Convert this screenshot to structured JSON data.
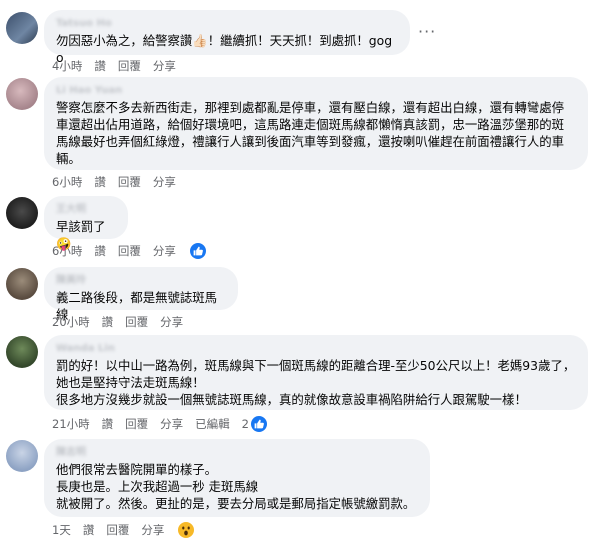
{
  "colors": {
    "bubble": "#f0f2f5",
    "meta_text": "#65676b",
    "like_blue": "#1877f2",
    "wow_yellow": "#f7b928"
  },
  "more_glyph": "···",
  "comments": [
    {
      "author": "Tatsuo Ho",
      "text": "勿因惡小為之，給警察讚👍🏻！繼續抓！天天抓！到處抓！gogo",
      "time": "4小時",
      "actions": [
        "讚",
        "回覆",
        "分享"
      ]
    },
    {
      "author": "Li Hao Yuan",
      "text": "警察怎麼不多去新西街走，那裡到處都亂是停車，還有壓白線，還有超出白線，還有轉彎處停車還超出佔用道路，給個好環境吧，這馬路連走個斑馬線都懶惰真該罰，忠一路溫莎堡那的斑馬線最好也弄個紅綠燈，禮讓行人讓到後面汽車等到發瘋，還按喇叭催趕在前面禮讓行人的車輛。",
      "time": "6小時",
      "actions": [
        "讚",
        "回覆",
        "分享"
      ]
    },
    {
      "author": "王大明",
      "text": "早該罰了🤪",
      "time": "6小時",
      "actions": [
        "讚",
        "回覆",
        "分享"
      ],
      "reaction": "like-icon"
    },
    {
      "author": "陳美玲",
      "text": "義二路後段，都是無號誌斑馬線",
      "time": "20小時",
      "actions": [
        "讚",
        "回覆",
        "分享"
      ]
    },
    {
      "author": "Wanda Lin",
      "text": "罰的好！以中山一路為例，斑馬線與下一個斑馬線的距離合理-至少50公尺以上！老媽93歲了，她也是堅持守法走斑馬線！\n很多地方沒幾步就設一個無號誌斑馬線，真的就像故意設車禍陷阱給行人跟駕駛一樣！",
      "time": "21小時",
      "actions": [
        "讚",
        "回覆",
        "分享",
        "已編輯"
      ],
      "reaction_count": "2",
      "reaction": "like-icon"
    },
    {
      "author": "陳志明",
      "text": "他們很常去醫院開單的樣子。\n長庚也是。上次我超過一秒 走斑馬線\n就被開了。然後。更扯的是，要去分局或是郵局指定帳號繳罰款。",
      "time": "1天",
      "actions": [
        "讚",
        "回覆",
        "分享"
      ],
      "reaction": "wow-icon"
    }
  ]
}
